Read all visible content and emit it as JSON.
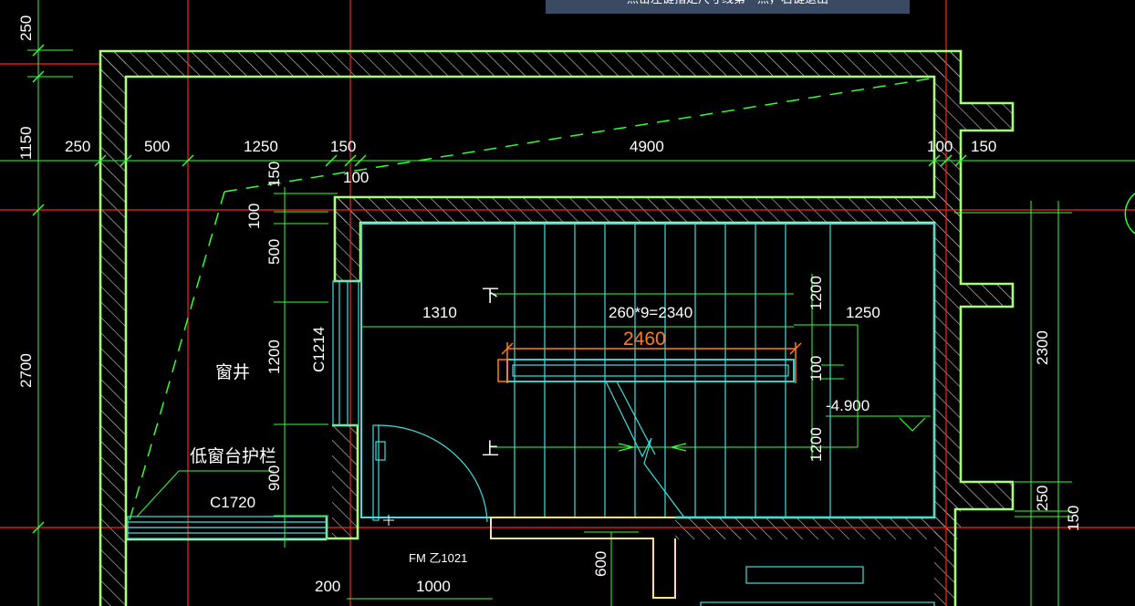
{
  "command_prompt": "点击左键指定尺寸线第一点，右键退出",
  "colors": {
    "background": "#000000",
    "wall": "#a8ff7a",
    "axis": "#ff2020",
    "dimension": "#33ff33",
    "stair": "#40e0e0",
    "highlight": "#ff7a1c",
    "door_sill": "#ffe680",
    "prompt_bg": "#3a4a63"
  },
  "dimensions": {
    "top_row": [
      "250",
      "500",
      "1250",
      "150",
      "4900",
      "100",
      "150"
    ],
    "left_vertical": [
      "250",
      "1150",
      "2700"
    ],
    "inner_vertical": [
      "150",
      "100",
      "500",
      "1200",
      "900"
    ],
    "misc": [
      "100",
      "1310",
      "260*9=2340",
      "1250",
      "1200",
      "1200",
      "100",
      "2300",
      "250",
      "150",
      "200",
      "1000",
      "600"
    ]
  },
  "labels": {
    "window_well": "窗井",
    "low_sill_guard": "低窗台护栏",
    "window_c1720": "C1720",
    "window_c1214": "C1214",
    "door_fm": "FM 乙1021",
    "stair_down": "下",
    "stair_up": "上",
    "elevation": "-4.900",
    "highlight_dim": "2460"
  },
  "icons": {
    "elevation_marker": "triangle-elevation-icon",
    "cursor": "crosshair-cursor-icon"
  }
}
